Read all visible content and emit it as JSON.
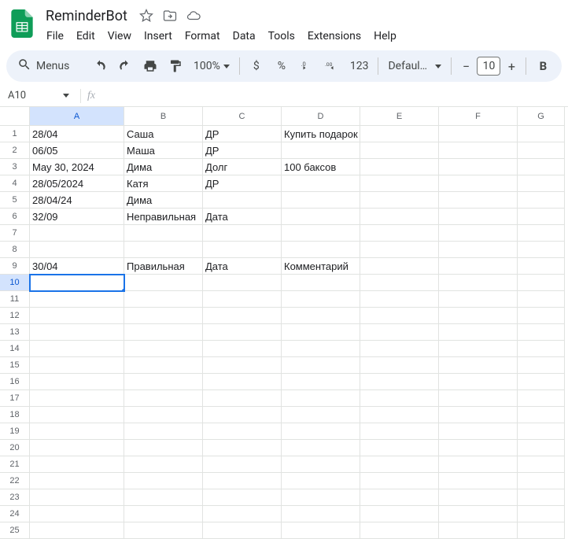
{
  "doc_title": "ReminderBot",
  "menus": [
    "File",
    "Edit",
    "View",
    "Insert",
    "Format",
    "Data",
    "Tools",
    "Extensions",
    "Help"
  ],
  "toolbar": {
    "search": "Menus",
    "zoom": "100%",
    "format_type": "123",
    "font": "Defaul…",
    "font_size": "10"
  },
  "name_box": "A10",
  "formula": "",
  "selected_cell": {
    "row": 10,
    "col": "A"
  },
  "columns": [
    "A",
    "B",
    "C",
    "D",
    "E",
    "F",
    "G"
  ],
  "num_rows": 25,
  "cells": {
    "A1": "28/04",
    "B1": "Саша",
    "C1": "ДР",
    "D1": "Купить подарок",
    "A2": "06/05",
    "B2": "Маша",
    "C2": "ДР",
    "A3": "May 30, 2024",
    "B3": "Дима",
    "C3": "Долг",
    "D3": "100 баксов",
    "A4": "28/05/2024",
    "B4": "Катя",
    "C4": "ДР",
    "A5": "28/04/24",
    "B5": "Дима",
    "A6": "32/09",
    "B6": "Неправильная",
    "C6": "Дата",
    "A9": "30/04",
    "B9": "Правильная",
    "C9": "Дата",
    "D9": "Комментарий"
  }
}
